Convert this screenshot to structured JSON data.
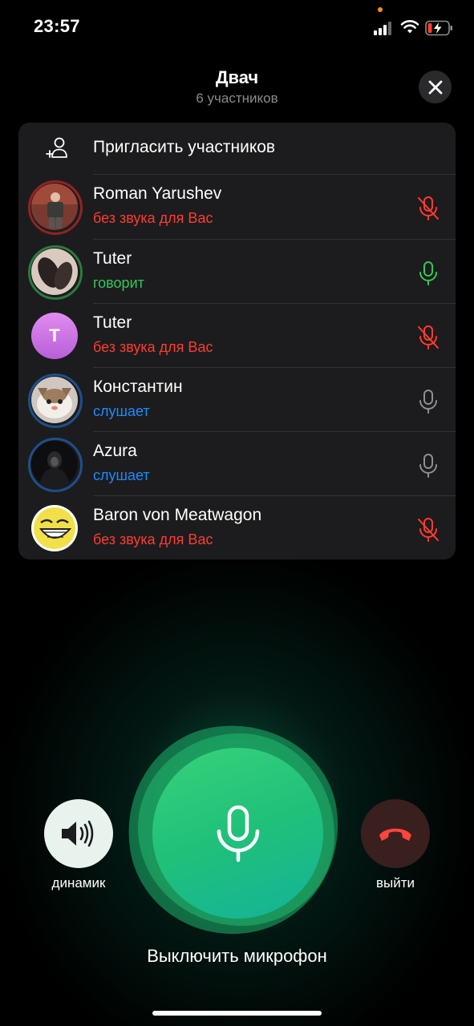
{
  "status_bar": {
    "time": "23:57"
  },
  "header": {
    "title": "Двач",
    "subtitle": "6 участников"
  },
  "invite": {
    "label": "Пригласить участников"
  },
  "participants": [
    {
      "name": "Roman Yarushev",
      "status": "без звука для Вас",
      "status_color": "#ff3b30",
      "mic": "mic-muted-icon",
      "ring_color": "#b02a2a"
    },
    {
      "name": "Tuter",
      "status": "говорит",
      "status_color": "#34c759",
      "mic": "mic-speaking-icon",
      "ring_color": "#2e8b4a"
    },
    {
      "name": "Tuter",
      "status": "без звука для Вас",
      "status_color": "#ff3b30",
      "mic": "mic-muted-icon",
      "avatar_letter": "T",
      "avatar_color": "#c86ee0"
    },
    {
      "name": "Константин",
      "status": "слушает",
      "status_color": "#1a8cff",
      "mic": "mic-icon",
      "ring_color": "#1e4f8a"
    },
    {
      "name": "Azura",
      "status": "слушает",
      "status_color": "#1a8cff",
      "mic": "mic-icon",
      "ring_color": "#1e4f8a"
    },
    {
      "name": "Baron von Meatwagon",
      "status": "без звука для Вас",
      "status_color": "#ff3b30",
      "mic": "mic-muted-icon"
    }
  ],
  "controls": {
    "speaker_label": "динамик",
    "leave_label": "выйти",
    "mic_label": "Выключить микрофон"
  },
  "colors": {
    "muted": "#ff3b30",
    "speaking": "#34c759",
    "listening": "#1a8cff",
    "panel": "#1c1c1e"
  }
}
